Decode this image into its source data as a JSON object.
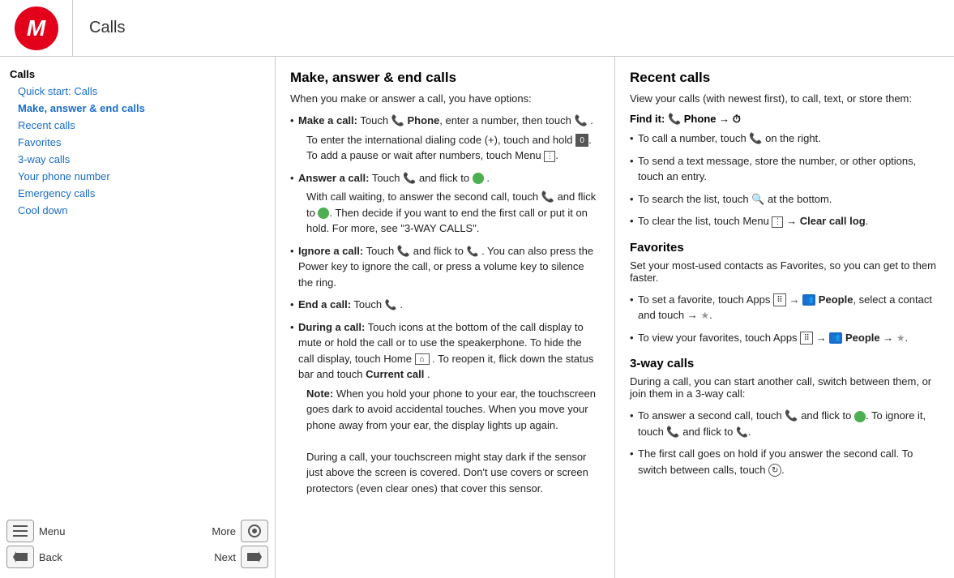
{
  "header": {
    "title": "Calls"
  },
  "sidebar": {
    "items": [
      {
        "label": "Calls",
        "level": "top"
      },
      {
        "label": "Quick start: Calls",
        "level": "indented"
      },
      {
        "label": "Make, answer & end calls",
        "level": "indented",
        "active": true
      },
      {
        "label": "Recent calls",
        "level": "indented"
      },
      {
        "label": "Favorites",
        "level": "indented"
      },
      {
        "label": "3-way calls",
        "level": "indented"
      },
      {
        "label": "Your phone number",
        "level": "indented"
      },
      {
        "label": "Emergency calls",
        "level": "indented"
      },
      {
        "label": "Cool down",
        "level": "indented"
      }
    ],
    "bottom": {
      "menu_label": "Menu",
      "more_label": "More",
      "back_label": "Back",
      "next_label": "Next"
    }
  },
  "make_answer": {
    "title": "Make, answer & end calls",
    "intro": "When you make or answer a call, you have options:",
    "bullets": [
      {
        "label": "Make a call:",
        "text": " Touch  Phone, enter a number, then touch .",
        "sub": "To enter the international dialing code (+), touch and hold . To add a pause or wait after numbers, touch Menu  ."
      },
      {
        "label": "Answer a call:",
        "text": " Touch  and flick to .",
        "sub": "With call waiting, to answer the second call, touch  and flick to . Then decide if you want to end the first call or put it on hold. For more, see \"3-WAY CALLS\"."
      },
      {
        "label": "Ignore a call:",
        "text": " Touch  and flick to . You can also press the Power key to ignore the call, or press a volume key to silence the ring."
      },
      {
        "label": "End a call:",
        "text": " Touch ."
      },
      {
        "label": "During a call:",
        "text": " Touch icons at the bottom of the call display to mute or hold the call or to use the speakerphone. To hide the call display, touch Home  . To reopen it, flick down the status bar and touch Current call.",
        "sub": "Note: When you hold your phone to your ear, the touchscreen goes dark to avoid accidental touches. When you move your phone away from your ear, the display lights up again.\n\nDuring a call, your touchscreen might stay dark if the sensor just above the screen is covered. Don't use covers or screen protectors (even clear ones) that cover this sensor."
      }
    ]
  },
  "recent_calls": {
    "title": "Recent calls",
    "intro": "View your calls (with newest first), to call, text, or store them:",
    "find_it": "Find it:  Phone →",
    "bullets": [
      "To call a number, touch  on the right.",
      "To send a text message, store the number, or other options, touch an entry.",
      "To search the list, touch  at the bottom.",
      "To clear the list, touch Menu  → Clear call log."
    ],
    "clear_log_bold": "Clear call log"
  },
  "favorites": {
    "title": "Favorites",
    "intro": "Set your most-used contacts as Favorites, so you can get to them faster.",
    "bullets": [
      "To set a favorite, touch Apps → People, select a contact and touch → .",
      "To view your favorites, touch Apps → People → ."
    ]
  },
  "three_way": {
    "title": "3-way calls",
    "intro": "During a call, you can start another call, switch between them, or join them in a 3-way call:",
    "bullets": [
      "To answer a second call, touch  and flick to . To ignore it, touch  and flick to .",
      "The first call goes on hold if you answer the second call. To switch between calls, touch ."
    ]
  }
}
